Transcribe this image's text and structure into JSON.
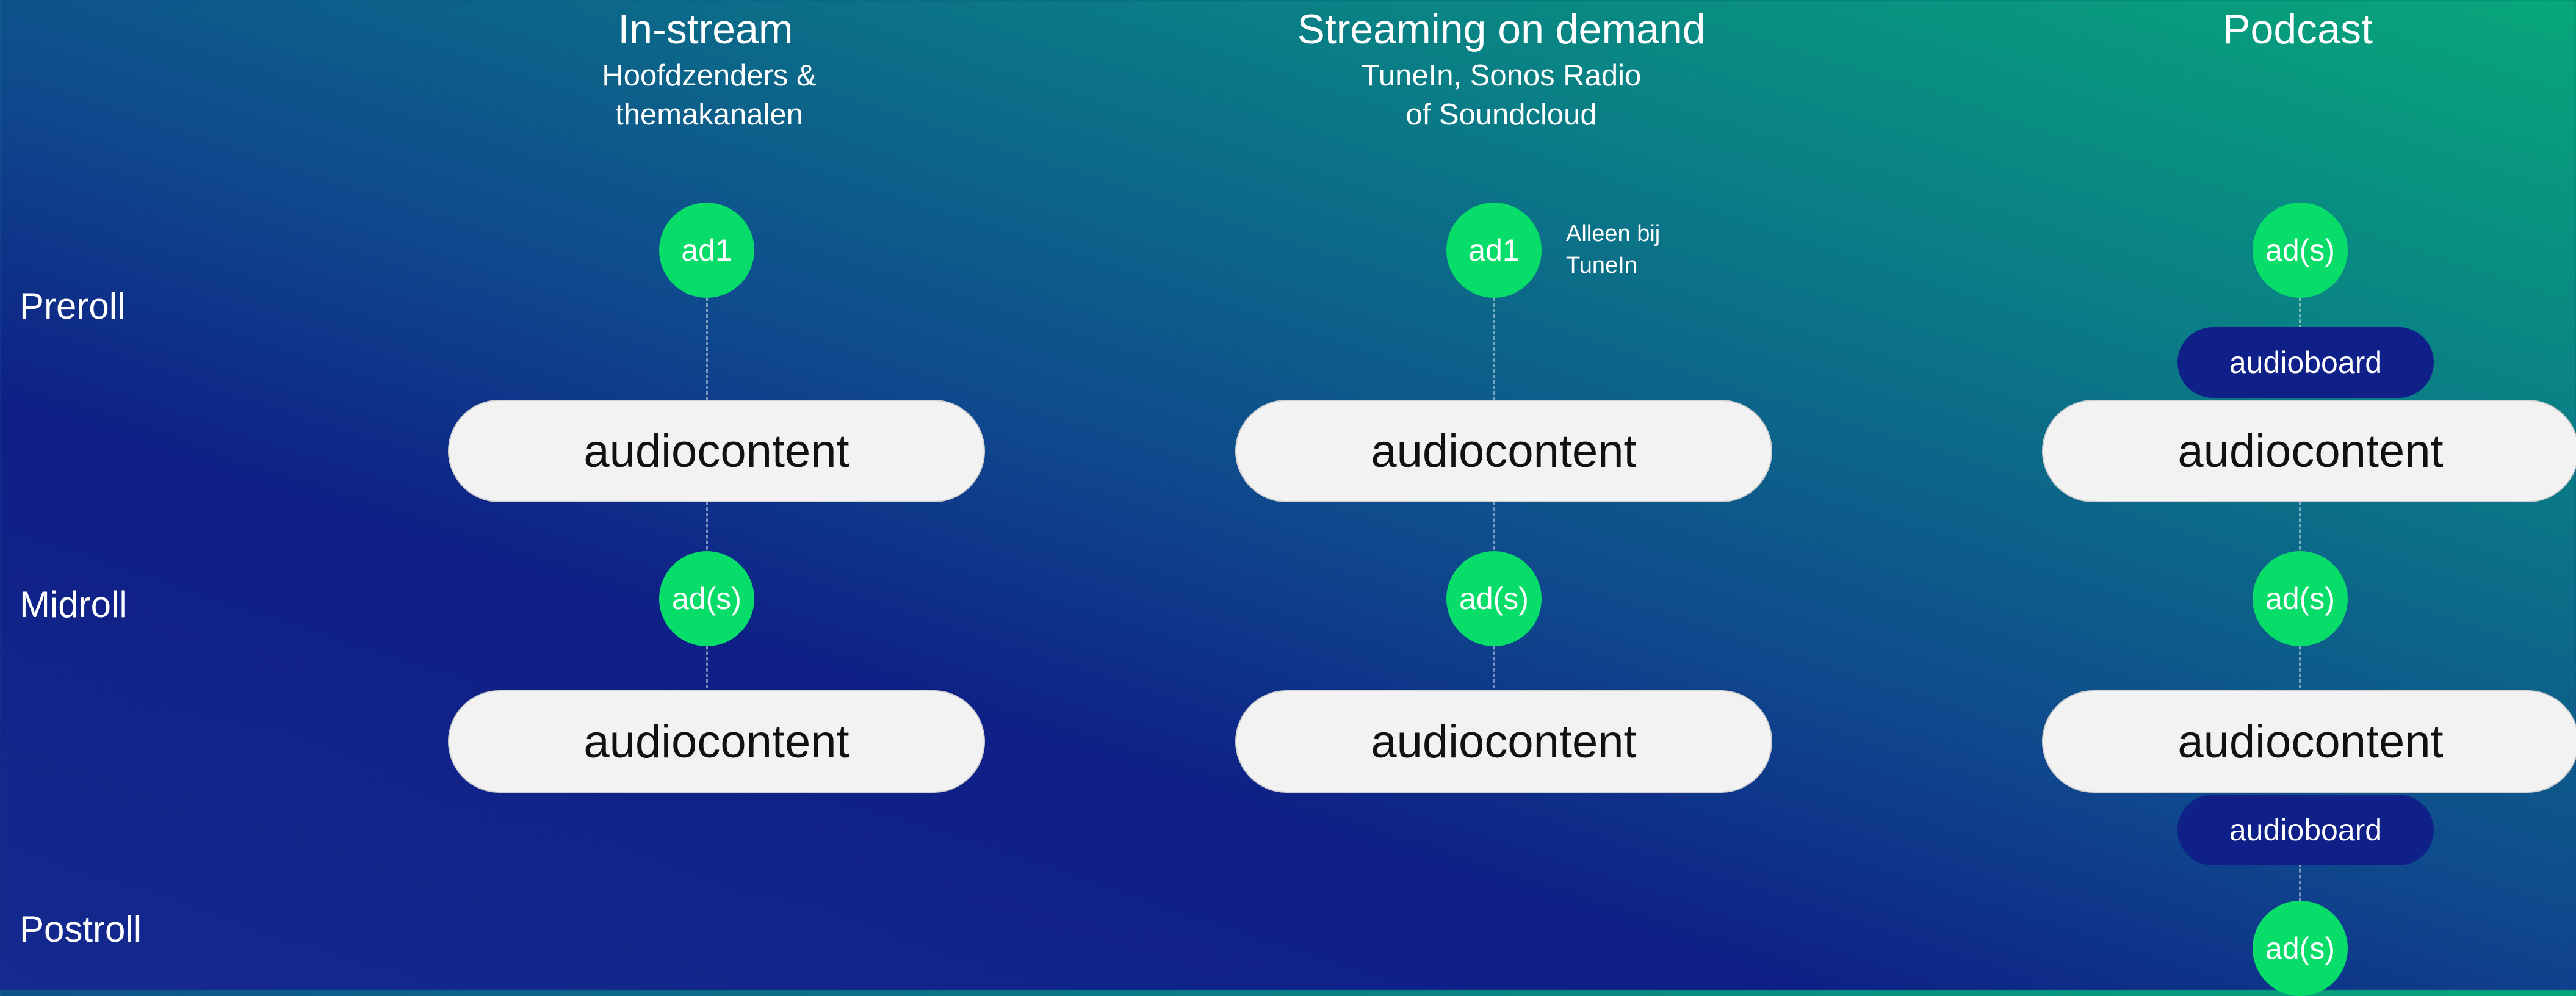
{
  "columns": [
    {
      "title": "In-stream",
      "subtitle_lines": [
        "Hoofdzenders &",
        "themakanalen"
      ]
    },
    {
      "title": "Streaming on demand",
      "subtitle_lines": [
        "TuneIn, Sonos Radio",
        "of Soundcloud"
      ]
    },
    {
      "title": "Podcast",
      "subtitle_lines": []
    }
  ],
  "rows": {
    "preroll": "Preroll",
    "midroll": "Midroll",
    "postroll": "Postroll"
  },
  "instream": {
    "preroll_ad": "ad1",
    "content_1": "audiocontent",
    "midroll_ad": "ad(s)",
    "content_2": "audiocontent"
  },
  "streaming": {
    "preroll_ad": "ad1",
    "preroll_note_lines": [
      "Alleen bij",
      "TuneIn"
    ],
    "content_1": "audiocontent",
    "midroll_ad": "ad(s)",
    "content_2": "audiocontent"
  },
  "podcast": {
    "preroll_ad": "ad(s)",
    "audioboard_1": "audioboard",
    "content_1": "audiocontent",
    "midroll_ad": "ad(s)",
    "content_2": "audiocontent",
    "audioboard_2": "audioboard",
    "postroll_ad": "ad(s)"
  },
  "colors": {
    "ad_circle": "#08dd6a",
    "audioboard": "#0f2088",
    "content_pill": "#f2f2f2"
  }
}
